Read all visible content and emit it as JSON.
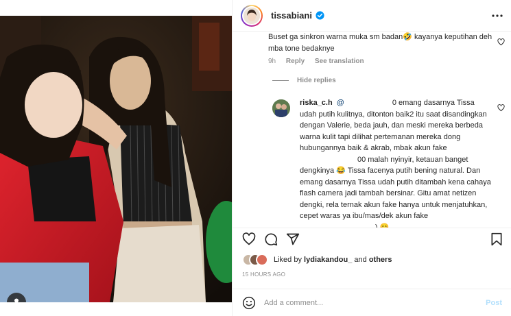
{
  "header": {
    "username": "tissabiani"
  },
  "comments": [
    {
      "text": "Buset ga sinkron warna muka sm badan🤣 kayanya keputihan deh mba tone bedaknye",
      "time": "9h",
      "reply_label": "Reply",
      "see_translation": "See translation"
    }
  ],
  "hide_replies": "Hide replies",
  "reply": {
    "username": "riska_c.h",
    "mention": "@",
    "text_a": "0 emang dasarnya Tissa udah putih kulitnya, ditonton baik2 itu saat disandingkan dengan Valerie, beda jauh, dan meski mereka berbeda warna kulit tapi dilihat pertemanan mereka dong hubungannya baik & akrab, mbak akun fake",
    "text_b": "00 malah nyinyir, ketauan banget dengkinya 😂 Tissa facenya putih bening natural. Dan emang dasarnya Tissa udah putih ditambah kena cahaya flash camera jadi tambah bersinar. Gitu amat netizen dengki, rela ternak akun fake hanya untuk menjatuhkan, cepet waras ya ibu/mas/dek akun fake",
    "text_c": ") 😊"
  },
  "likes": {
    "prefix": "Liked by",
    "user": "lydiakandou_",
    "and": "and",
    "others": "others"
  },
  "timestamp": "15 HOURS AGO",
  "add_comment": {
    "placeholder": "Add a comment...",
    "post_label": "Post"
  },
  "icons": {
    "verified": "verified-badge-icon",
    "more": "more-options-icon",
    "like": "heart-icon",
    "comment": "comment-icon",
    "share": "share-icon",
    "save": "bookmark-icon",
    "emoji": "emoji-icon",
    "user_tag": "user-tag-icon"
  },
  "colors": {
    "accent_blue": "#0095f6",
    "post_disabled": "#b2dffc",
    "muted": "#8e8e8e",
    "text": "#262626",
    "mention": "#00376b"
  }
}
